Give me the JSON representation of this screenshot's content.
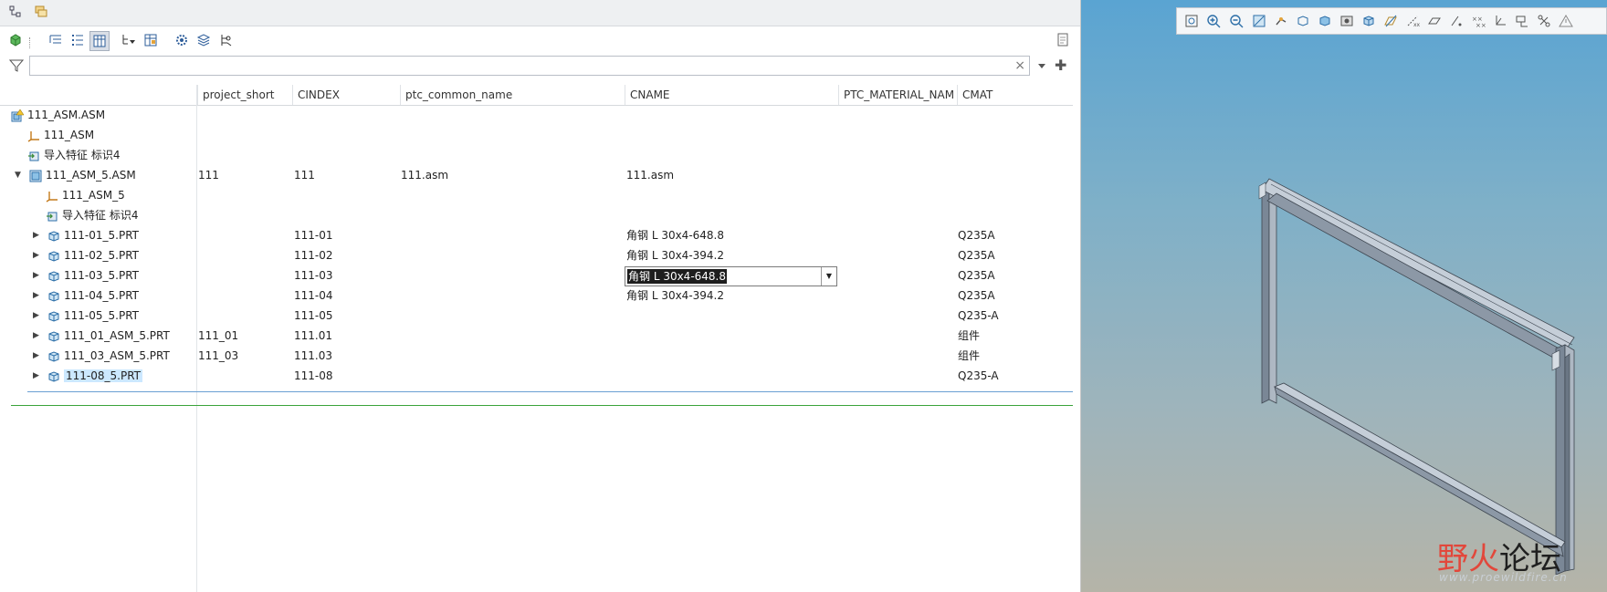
{
  "columns": [
    "project_short",
    "CINDEX",
    "ptc_common_name",
    "CNAME",
    "PTC_MATERIAL_NAM",
    "CMAT"
  ],
  "rows": [
    {
      "label": "111_ASM.ASM",
      "project_short": "",
      "cindex": "",
      "common": "",
      "cname": "",
      "cmat": ""
    },
    {
      "label": "111_ASM",
      "project_short": "",
      "cindex": "",
      "common": "",
      "cname": "",
      "cmat": ""
    },
    {
      "label": "导入特征 标识4",
      "project_short": "",
      "cindex": "",
      "common": "",
      "cname": "",
      "cmat": ""
    },
    {
      "label": "111_ASM_5.ASM",
      "project_short": "111",
      "cindex": "111",
      "common": "111.asm",
      "cname": "111.asm",
      "cmat": ""
    },
    {
      "label": "111_ASM_5",
      "project_short": "",
      "cindex": "",
      "common": "",
      "cname": "",
      "cmat": ""
    },
    {
      "label": "导入特征 标识4",
      "project_short": "",
      "cindex": "",
      "common": "",
      "cname": "",
      "cmat": ""
    },
    {
      "label": "111-01_5.PRT",
      "project_short": "",
      "cindex": "111-01",
      "common": "",
      "cname": "角钢 L 30x4-648.8",
      "cmat": "Q235A"
    },
    {
      "label": "111-02_5.PRT",
      "project_short": "",
      "cindex": "111-02",
      "common": "",
      "cname": "角钢 L 30x4-394.2",
      "cmat": "Q235A"
    },
    {
      "label": "111-03_5.PRT",
      "project_short": "",
      "cindex": "111-03",
      "common": "",
      "cname": "",
      "cmat": "Q235A"
    },
    {
      "label": "111-04_5.PRT",
      "project_short": "",
      "cindex": "111-04",
      "common": "",
      "cname": "角钢 L 30x4-394.2",
      "cmat": "Q235A"
    },
    {
      "label": "111-05_5.PRT",
      "project_short": "",
      "cindex": "111-05",
      "common": "",
      "cname": "",
      "cmat": "Q235-A"
    },
    {
      "label": "111_01_ASM_5.PRT",
      "project_short": "111_01",
      "cindex": "111.01",
      "common": "",
      "cname": "",
      "cmat": "组件"
    },
    {
      "label": "111_03_ASM_5.PRT",
      "project_short": "111_03",
      "cindex": "111.03",
      "common": "",
      "cname": "",
      "cmat": "组件"
    },
    {
      "label": "111-08_5.PRT",
      "project_short": "",
      "cindex": "111-08",
      "common": "",
      "cname": "",
      "cmat": "Q235-A"
    }
  ],
  "edit_dropdown": {
    "value": "角钢 L 30x4-648.8"
  },
  "filter": {
    "value": "",
    "clear": "×"
  },
  "watermark": {
    "main_a": "野火",
    "main_b": "论坛",
    "url": "www.proewildfire.cn"
  },
  "colors": {
    "selected": "#cce8ff",
    "viewport_top": "#5aa4d2",
    "viewport_bottom": "#b5b4a8",
    "watermark_red": "#e2473b"
  }
}
